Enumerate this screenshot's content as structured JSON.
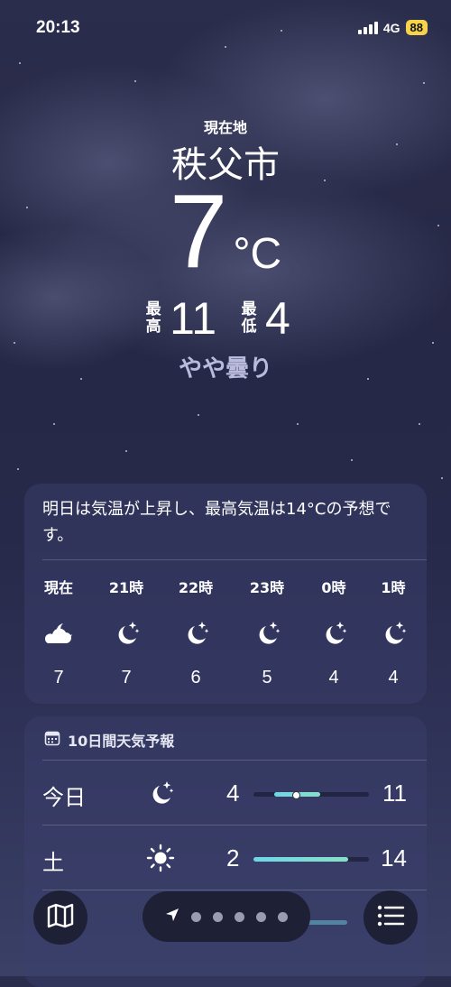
{
  "status_bar": {
    "time": "20:13",
    "network": "4G",
    "battery": "88"
  },
  "header": {
    "location_label": "現在地",
    "city": "秩父市",
    "temperature": "7",
    "unit": "°C",
    "high_label": "最高",
    "high": "11",
    "low_label": "最低",
    "low": "4",
    "condition": "やや曇り"
  },
  "hourly": {
    "summary": "明日は気温が上昇し、最高気温は14°Cの予想です。",
    "items": [
      {
        "label": "現在",
        "icon": "partly-cloudy-night-icon",
        "temp": "7"
      },
      {
        "label": "21時",
        "icon": "moon-stars-icon",
        "temp": "7"
      },
      {
        "label": "22時",
        "icon": "moon-stars-icon",
        "temp": "6"
      },
      {
        "label": "23時",
        "icon": "moon-stars-icon",
        "temp": "5"
      },
      {
        "label": "0時",
        "icon": "moon-stars-icon",
        "temp": "4"
      },
      {
        "label": "1時",
        "icon": "moon-stars-icon",
        "temp": "4"
      }
    ]
  },
  "daily": {
    "title": "10日間天気予報",
    "days": [
      {
        "day": "今日",
        "icon": "moon-stars-icon",
        "low": "4",
        "high": "11",
        "range_start": 0.18,
        "range_end": 0.58,
        "current": 0.36
      },
      {
        "day": "土",
        "icon": "sun-icon",
        "low": "2",
        "high": "14",
        "range_start": 0.0,
        "range_end": 0.82
      }
    ]
  },
  "toolbar": {
    "map": "map-icon",
    "location": "location-arrow-icon",
    "list": "list-icon",
    "page_count": 5
  }
}
